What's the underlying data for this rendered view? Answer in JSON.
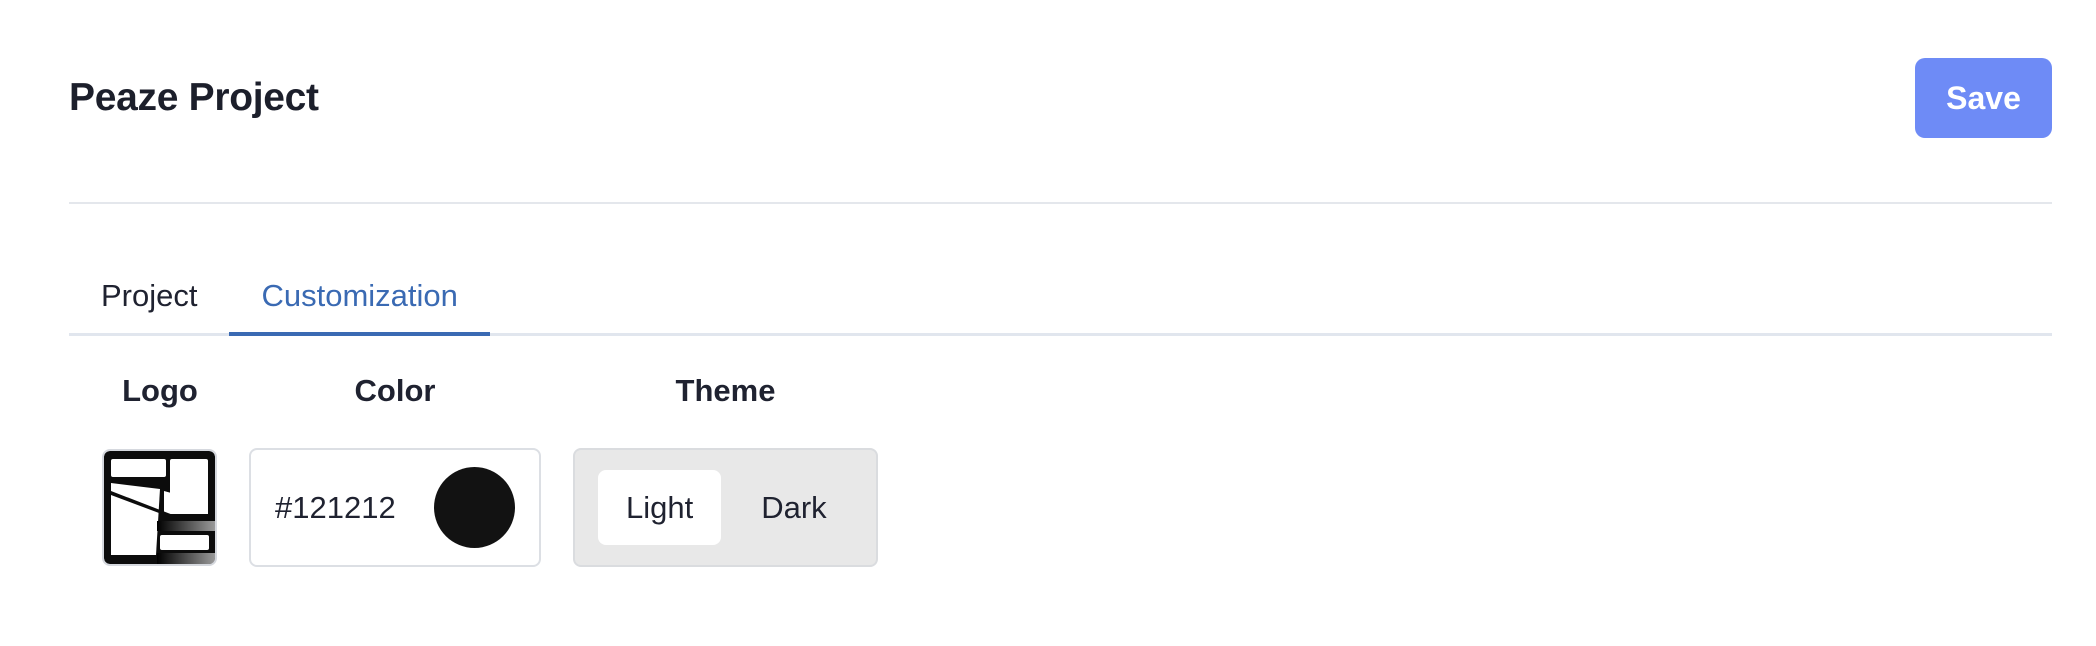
{
  "header": {
    "title": "Peaze Project",
    "save_label": "Save"
  },
  "tabs": [
    {
      "label": "Project",
      "active": false
    },
    {
      "label": "Customization",
      "active": true
    }
  ],
  "customization": {
    "logo_label": "Logo",
    "color_label": "Color",
    "theme_label": "Theme",
    "color_value": "#121212",
    "theme_options": [
      "Light",
      "Dark"
    ],
    "selected_theme": "Light"
  },
  "colors": {
    "accent": "#6e8bf6",
    "tab_active": "#3a6ab3",
    "swatch": "#121212"
  }
}
